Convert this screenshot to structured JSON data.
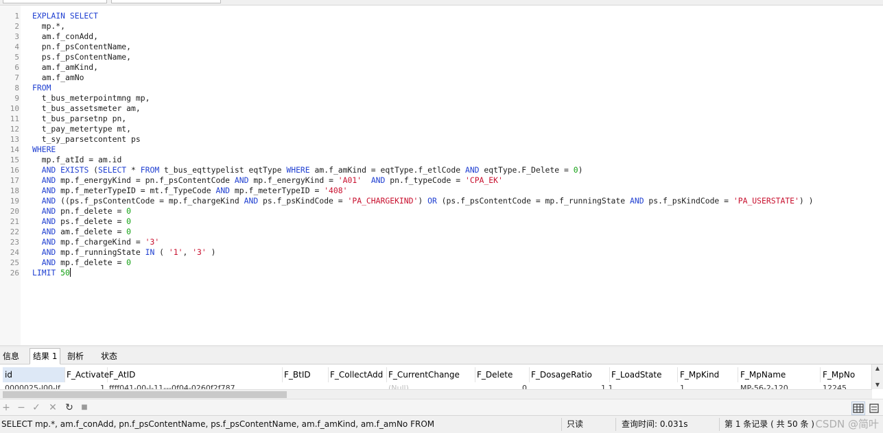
{
  "editor": {
    "lines": [
      {
        "n": "1",
        "tokens": [
          {
            "t": "EXPLAIN SELECT",
            "c": "kw"
          }
        ]
      },
      {
        "n": "2",
        "tokens": [
          {
            "t": "  mp.*,",
            "c": "id"
          }
        ]
      },
      {
        "n": "3",
        "tokens": [
          {
            "t": "  am.f_conAdd,",
            "c": "id"
          }
        ]
      },
      {
        "n": "4",
        "tokens": [
          {
            "t": "  pn.f_psContentName,",
            "c": "id"
          }
        ]
      },
      {
        "n": "5",
        "tokens": [
          {
            "t": "  ps.f_psContentName,",
            "c": "id"
          }
        ]
      },
      {
        "n": "6",
        "tokens": [
          {
            "t": "  am.f_amKind,",
            "c": "id"
          }
        ]
      },
      {
        "n": "7",
        "tokens": [
          {
            "t": "  am.f_amNo",
            "c": "id"
          }
        ]
      },
      {
        "n": "8",
        "tokens": [
          {
            "t": "FROM",
            "c": "kw"
          }
        ]
      },
      {
        "n": "9",
        "tokens": [
          {
            "t": "  t_bus_meterpointmng mp,",
            "c": "id"
          }
        ]
      },
      {
        "n": "10",
        "tokens": [
          {
            "t": "  t_bus_assetsmeter am,",
            "c": "id"
          }
        ]
      },
      {
        "n": "11",
        "tokens": [
          {
            "t": "  t_bus_parsetnp pn,",
            "c": "id"
          }
        ]
      },
      {
        "n": "12",
        "tokens": [
          {
            "t": "  t_pay_metertype mt,",
            "c": "id"
          }
        ]
      },
      {
        "n": "13",
        "tokens": [
          {
            "t": "  t_sy_parsetcontent ps",
            "c": "id"
          }
        ]
      },
      {
        "n": "14",
        "tokens": [
          {
            "t": "WHERE",
            "c": "kw"
          }
        ]
      },
      {
        "n": "15",
        "tokens": [
          {
            "t": "  mp.f_atId = am.id",
            "c": "id"
          }
        ]
      },
      {
        "n": "16",
        "tokens": [
          {
            "t": "  ",
            "c": "id"
          },
          {
            "t": "AND EXISTS",
            "c": "kw"
          },
          {
            "t": " (",
            "c": "id"
          },
          {
            "t": "SELECT",
            "c": "kw"
          },
          {
            "t": " * ",
            "c": "id"
          },
          {
            "t": "FROM",
            "c": "kw"
          },
          {
            "t": " t_bus_eqttypelist eqtType ",
            "c": "id"
          },
          {
            "t": "WHERE",
            "c": "kw"
          },
          {
            "t": " am.f_amKind = eqtType.f_etlCode ",
            "c": "id"
          },
          {
            "t": "AND",
            "c": "kw"
          },
          {
            "t": " eqtType.F_Delete = ",
            "c": "id"
          },
          {
            "t": "0",
            "c": "num"
          },
          {
            "t": ")",
            "c": "id"
          }
        ]
      },
      {
        "n": "17",
        "tokens": [
          {
            "t": "  ",
            "c": "id"
          },
          {
            "t": "AND",
            "c": "kw"
          },
          {
            "t": " mp.f_energyKind = pn.f_psContentCode ",
            "c": "id"
          },
          {
            "t": "AND",
            "c": "kw"
          },
          {
            "t": " mp.f_energyKind = ",
            "c": "id"
          },
          {
            "t": "'A01'",
            "c": "str"
          },
          {
            "t": "  ",
            "c": "id"
          },
          {
            "t": "AND",
            "c": "kw"
          },
          {
            "t": " pn.f_typeCode = ",
            "c": "id"
          },
          {
            "t": "'CPA_EK'",
            "c": "str"
          }
        ]
      },
      {
        "n": "18",
        "tokens": [
          {
            "t": "  ",
            "c": "id"
          },
          {
            "t": "AND",
            "c": "kw"
          },
          {
            "t": " mp.f_meterTypeID = mt.f_TypeCode ",
            "c": "id"
          },
          {
            "t": "AND",
            "c": "kw"
          },
          {
            "t": " mp.f_meterTypeID = ",
            "c": "id"
          },
          {
            "t": "'408'",
            "c": "str"
          }
        ]
      },
      {
        "n": "19",
        "tokens": [
          {
            "t": "  ",
            "c": "id"
          },
          {
            "t": "AND",
            "c": "kw"
          },
          {
            "t": " ((ps.f_psContentCode = mp.f_chargeKind ",
            "c": "id"
          },
          {
            "t": "AND",
            "c": "kw"
          },
          {
            "t": " ps.f_psKindCode = ",
            "c": "id"
          },
          {
            "t": "'PA_CHARGEKIND'",
            "c": "str"
          },
          {
            "t": ") ",
            "c": "id"
          },
          {
            "t": "OR",
            "c": "kw"
          },
          {
            "t": " (ps.f_psContentCode = mp.f_runningState ",
            "c": "id"
          },
          {
            "t": "AND",
            "c": "kw"
          },
          {
            "t": " ps.f_psKindCode = ",
            "c": "id"
          },
          {
            "t": "'PA_USERSTATE'",
            "c": "str"
          },
          {
            "t": ") )",
            "c": "id"
          }
        ]
      },
      {
        "n": "20",
        "tokens": [
          {
            "t": "  ",
            "c": "id"
          },
          {
            "t": "AND",
            "c": "kw"
          },
          {
            "t": " pn.f_delete = ",
            "c": "id"
          },
          {
            "t": "0",
            "c": "num"
          }
        ]
      },
      {
        "n": "21",
        "tokens": [
          {
            "t": "  ",
            "c": "id"
          },
          {
            "t": "AND",
            "c": "kw"
          },
          {
            "t": " ps.f_delete = ",
            "c": "id"
          },
          {
            "t": "0",
            "c": "num"
          }
        ]
      },
      {
        "n": "22",
        "tokens": [
          {
            "t": "  ",
            "c": "id"
          },
          {
            "t": "AND",
            "c": "kw"
          },
          {
            "t": " am.f_delete = ",
            "c": "id"
          },
          {
            "t": "0",
            "c": "num"
          }
        ]
      },
      {
        "n": "23",
        "tokens": [
          {
            "t": "  ",
            "c": "id"
          },
          {
            "t": "AND",
            "c": "kw"
          },
          {
            "t": " mp.f_chargeKind = ",
            "c": "id"
          },
          {
            "t": "'3'",
            "c": "str"
          }
        ]
      },
      {
        "n": "24",
        "tokens": [
          {
            "t": "  ",
            "c": "id"
          },
          {
            "t": "AND",
            "c": "kw"
          },
          {
            "t": " mp.f_runningState ",
            "c": "id"
          },
          {
            "t": "IN",
            "c": "kw"
          },
          {
            "t": " ( ",
            "c": "id"
          },
          {
            "t": "'1'",
            "c": "str"
          },
          {
            "t": ", ",
            "c": "id"
          },
          {
            "t": "'3'",
            "c": "str"
          },
          {
            "t": " )",
            "c": "id"
          }
        ]
      },
      {
        "n": "25",
        "tokens": [
          {
            "t": "  ",
            "c": "id"
          },
          {
            "t": "AND",
            "c": "kw"
          },
          {
            "t": " mp.f_delete = ",
            "c": "id"
          },
          {
            "t": "0",
            "c": "num"
          }
        ]
      },
      {
        "n": "26",
        "tokens": [
          {
            "t": "LIMIT",
            "c": "kw"
          },
          {
            "t": " ",
            "c": "id"
          },
          {
            "t": "50",
            "c": "num"
          }
        ]
      }
    ]
  },
  "result_tabs": [
    "信息",
    "结果 1",
    "剖析",
    "状态"
  ],
  "active_tab": "结果 1",
  "grid": {
    "columns": [
      "id",
      "F_Activate",
      "F_AtID",
      "F_BtID",
      "F_CollectAdd",
      "F_CurrentChange",
      "F_Delete",
      "F_DosageRatio",
      "F_LoadState",
      "F_MpKind",
      "F_MpName",
      "F_MpNo"
    ],
    "partial_row": [
      "0000025-l00-lf",
      "1",
      "ffff041-00-l-11---0f04-0260f2f787",
      "",
      "",
      "(Null)",
      "0",
      "1.1",
      "",
      "1",
      "MP-56-2-120",
      "12245"
    ]
  },
  "toolbar": {
    "add": "+",
    "remove": "−",
    "apply": "✓",
    "discard": "✕",
    "refresh": "↻",
    "stop": "■"
  },
  "status": {
    "sql": "SELECT    mp.*,        am.f_conAdd,         pn.f_psContentName,           ps.f_psContentName,           am.f_amKind,          am.f_amNo   FROM",
    "mode": "只读",
    "query_time": "查询时间: 0.031s",
    "records": "第 1 条记录 ( 共 50 条 )",
    "watermark": "CSDN @简叶"
  }
}
